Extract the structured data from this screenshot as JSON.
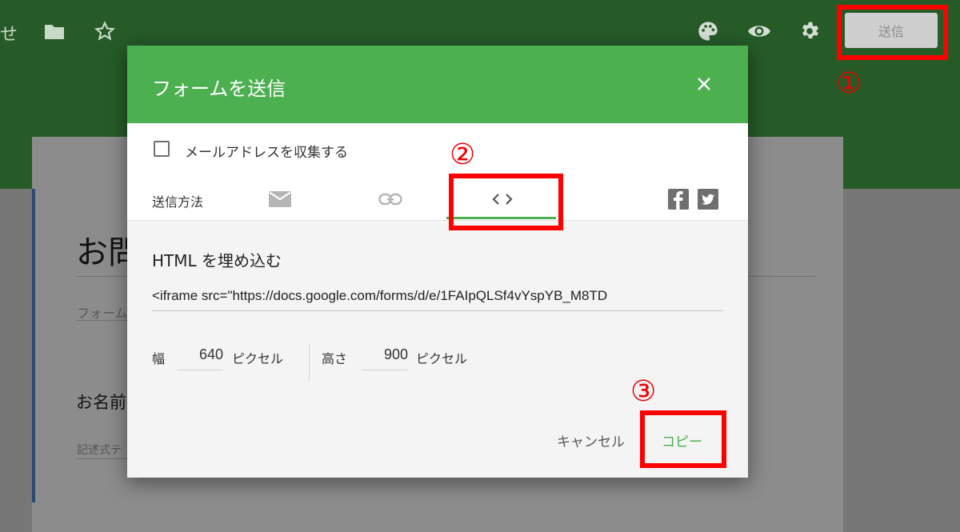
{
  "app": {
    "toolbar_text": "せ",
    "send_button": "送信"
  },
  "form": {
    "title": "お問",
    "description": "フォーム",
    "question_title": "お名前",
    "question_placeholder": "記述式テ"
  },
  "dialog": {
    "title": "フォームを送信",
    "collect_email_label": "メールアドレスを収集する",
    "send_via_label": "送信方法",
    "send_methods": [
      "email-icon",
      "link-icon",
      "embed-code-icon"
    ],
    "active_method": "embed-code-icon",
    "share_icons": [
      "facebook-icon",
      "twitter-icon"
    ],
    "embed": {
      "heading": "HTML を埋め込む",
      "code": "<iframe src=\"https://docs.google.com/forms/d/e/1FAIpQLSf4vYspYB_M8TD",
      "width_label": "幅",
      "width_value": "640",
      "width_unit": "ピクセル",
      "height_label": "高さ",
      "height_value": "900",
      "height_unit": "ピクセル"
    },
    "cancel_button": "キャンセル",
    "copy_button": "コピー"
  },
  "annotations": {
    "step1": "①",
    "step2": "②",
    "step3": "③",
    "highlight_color": "#ff0000"
  },
  "colors": {
    "header_green": "#4caf50",
    "topbar_green": "#265b28"
  }
}
